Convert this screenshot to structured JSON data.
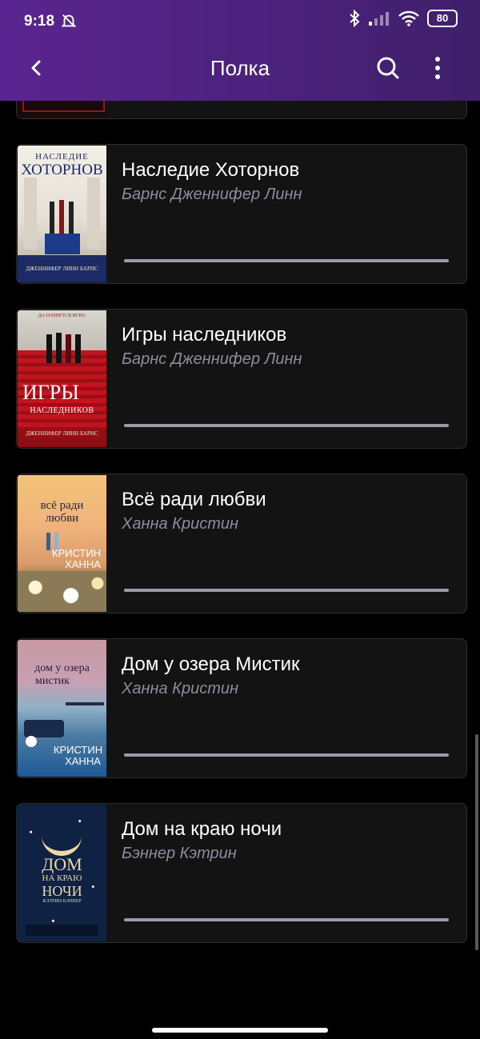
{
  "status_bar": {
    "time": "9:18",
    "battery": "80"
  },
  "toolbar": {
    "title": "Полка"
  },
  "books": [
    {
      "title": "Наследие Хоторнов",
      "author": "Барнс Дженнифер Линн",
      "progress": 1.0,
      "cover_top": "НАСЛЕДИЕ",
      "cover_title": "ХОТОРНОВ",
      "cover_bottom": "ДЖЕННИФЕР ЛИНН БАРНС"
    },
    {
      "title": "Игры наследников",
      "author": "Барнс Дженнифер Линн",
      "progress": 1.0,
      "cover_top": "ДА НАЧНЕТСЯ ИГРА!",
      "cover_title": "ИГРЫ",
      "cover_title2": "НАСЛЕДНИКОВ",
      "cover_bottom": "ДЖЕННИФЕР ЛИНН БАРНС"
    },
    {
      "title": "Всё ради любви",
      "author": "Ханна Кристин",
      "progress": 1.0,
      "cover_title": "всё ради",
      "cover_title2": "любви",
      "cover_author": "КРИСТИН",
      "cover_author2": "ХАННА"
    },
    {
      "title": "Дом у озера Мистик",
      "author": "Ханна Кристин",
      "progress": 1.0,
      "cover_title": "дом у озера",
      "cover_title2": "мистик",
      "cover_author": "КРИСТИН",
      "cover_author2": "ХАННА"
    },
    {
      "title": "Дом на краю ночи",
      "author": "Бэннер Кэтрин",
      "progress": 1.0,
      "cover_title": "ДОМ",
      "cover_title2": "НА КРАЮ",
      "cover_title3": "НОЧИ",
      "cover_author": "КЭТРИН БЭННЕР"
    }
  ],
  "colors": {
    "appbar": "#4a227a",
    "card_bg": "#131313",
    "author_text": "#8c8c9c",
    "progress_fill": "#9a9aa8"
  }
}
